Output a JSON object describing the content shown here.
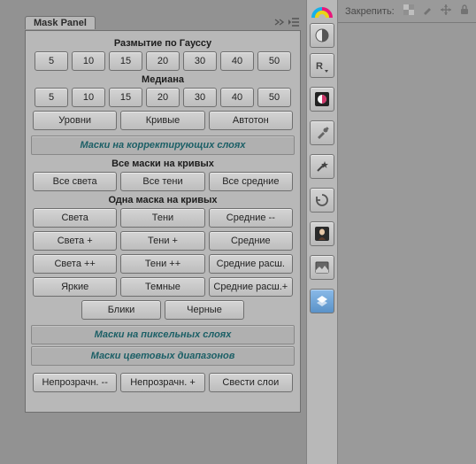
{
  "panel": {
    "title": "Mask Panel"
  },
  "sections": {
    "gauss": "Размытие по Гауссу",
    "median": "Медиана",
    "adj_layers": "Маски на корректирующих слоях",
    "all_curves": "Все маски на кривых",
    "one_curve": "Одна маска на кривых",
    "pixel_layers": "Маски на пиксельных слоях",
    "color_ranges": "Маски цветовых диапазонов"
  },
  "blur_vals": [
    "5",
    "10",
    "15",
    "20",
    "30",
    "40",
    "50"
  ],
  "median_vals": [
    "5",
    "10",
    "15",
    "20",
    "30",
    "40",
    "50"
  ],
  "adjust": {
    "levels": "Уровни",
    "curves": "Кривые",
    "auto": "Автотон"
  },
  "all_curves_btns": {
    "lights": "Все света",
    "shadows": "Все тени",
    "mids": "Все средние"
  },
  "one_curve_rows": [
    [
      "Света",
      "Тени",
      "Средние --"
    ],
    [
      "Света +",
      "Тени +",
      "Средние"
    ],
    [
      "Света ++",
      "Тени ++",
      "Средние расш."
    ],
    [
      "Яркие",
      "Темные",
      "Средние расш.+"
    ]
  ],
  "one_curve_pair": [
    "Блики",
    "Черные"
  ],
  "opacity_row": [
    "Непрозрачн. --",
    "Непрозрачн. +",
    "Свести слои"
  ],
  "top_right": {
    "lock_label": "Закрепить:"
  }
}
